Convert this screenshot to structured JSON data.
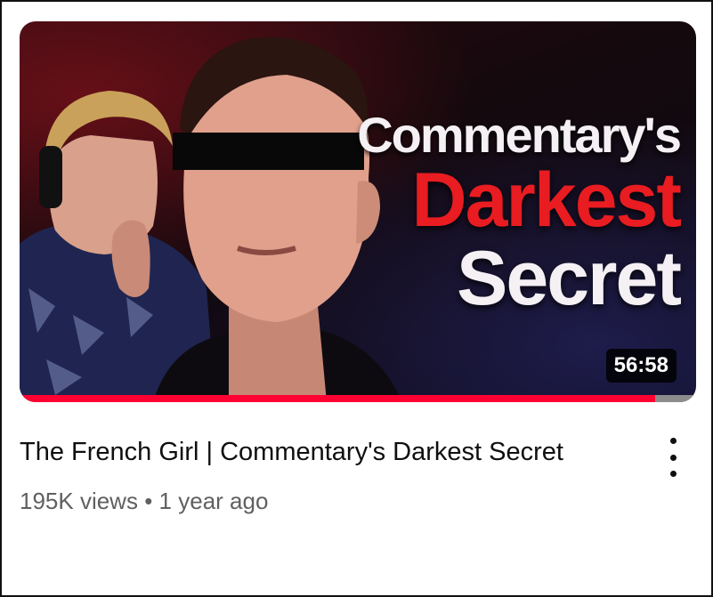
{
  "video": {
    "thumbnail": {
      "overlay_line1": "Commentary's",
      "overlay_line2": "Darkest",
      "overlay_line3": "Secret",
      "overlay_colors": {
        "line1": "#f4f0f4",
        "line2": "#e81c21",
        "line3": "#f4f0f4"
      },
      "duration": "56:58",
      "watched_progress_fraction": 0.94,
      "progress_color": "#ff0033"
    },
    "title": "The French Girl | Commentary's Darkest Secret",
    "views": "195K views",
    "separator": "•",
    "age": "1 year ago",
    "menu_icon": "more-vertical-icon"
  }
}
